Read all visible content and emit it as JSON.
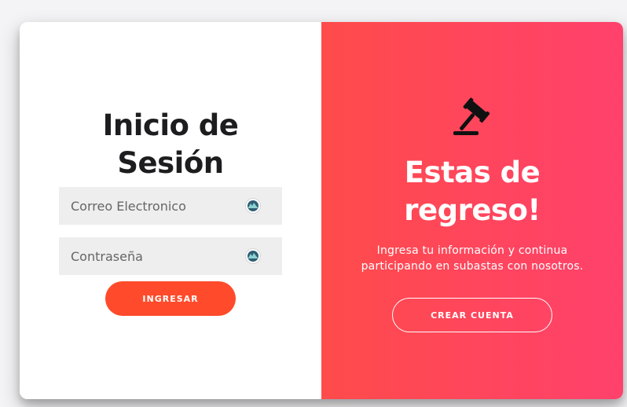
{
  "login": {
    "title_line1": "Inicio de",
    "title_line2": "Sesión",
    "email_placeholder": "Correo Electronico",
    "password_placeholder": "Contraseña",
    "submit_label": "INGRESAR",
    "field_icon": "vpn-shield-icon"
  },
  "welcome": {
    "icon": "gavel-icon",
    "title_line1": "Estas de",
    "title_line2": "regreso!",
    "description_line1": "Ingresa tu información y continua",
    "description_line2": "participando en subastas con nosotros.",
    "create_label": "CREAR CUENTA"
  },
  "colors": {
    "accent": "#ff4b2b",
    "gradient_start": "#ff4b4b",
    "gradient_end": "#ff416c",
    "field_bg": "#eeeeee"
  }
}
